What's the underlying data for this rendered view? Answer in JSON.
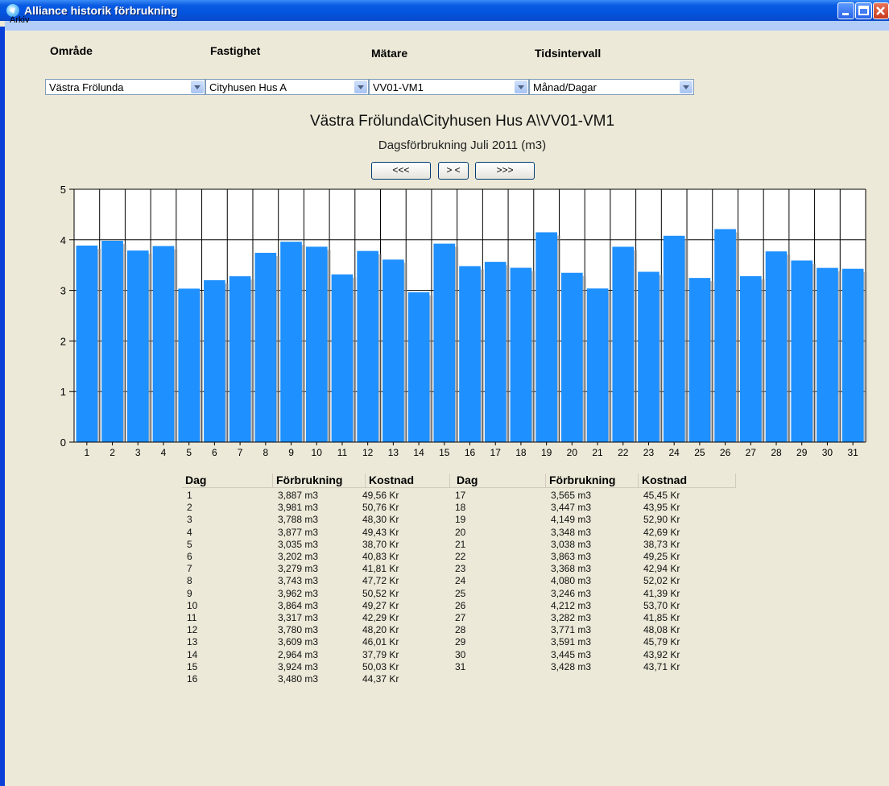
{
  "window": {
    "title": "Alliance historik förbrukning"
  },
  "menu": {
    "items": [
      "Arkiv"
    ]
  },
  "filters": {
    "area": {
      "label": "Område",
      "value": "Västra Frölunda"
    },
    "property": {
      "label": "Fastighet",
      "value": "Cityhusen Hus A"
    },
    "meter": {
      "label": "Mätare",
      "value": "VV01-VM1"
    },
    "interval": {
      "label": "Tidsintervall",
      "value": "Månad/Dagar"
    }
  },
  "navigation": {
    "prev": "<<<",
    "center": "> <",
    "next": ">>>"
  },
  "colors": {
    "bar": "#1e90ff",
    "titlebar": "#0354df",
    "background": "#ece9d8"
  },
  "chart_data": {
    "type": "bar",
    "title": "Västra Frölunda\\Cityhusen Hus A\\VV01-VM1",
    "subtitle": "Dagsförbrukning Juli 2011 (m3)",
    "categories": [
      "1",
      "2",
      "3",
      "4",
      "5",
      "6",
      "7",
      "8",
      "9",
      "10",
      "11",
      "12",
      "13",
      "14",
      "15",
      "16",
      "17",
      "18",
      "19",
      "20",
      "21",
      "22",
      "23",
      "24",
      "25",
      "26",
      "27",
      "28",
      "29",
      "30",
      "31"
    ],
    "values": [
      3.887,
      3.981,
      3.788,
      3.877,
      3.035,
      3.202,
      3.279,
      3.743,
      3.962,
      3.864,
      3.317,
      3.78,
      3.609,
      2.964,
      3.924,
      3.48,
      3.565,
      3.447,
      4.149,
      3.348,
      3.038,
      3.863,
      3.368,
      4.08,
      3.246,
      4.212,
      3.282,
      3.771,
      3.591,
      3.445,
      3.428
    ],
    "yticks": [
      "0",
      "1",
      "2",
      "3",
      "4",
      "5"
    ],
    "ylim": [
      0,
      5
    ],
    "grid": true,
    "legend": "none"
  },
  "table": {
    "headers": {
      "day": "Dag",
      "usage": "Förbrukning",
      "cost": "Kostnad"
    },
    "left": [
      {
        "day": "1",
        "usage": "3,887 m3",
        "cost": "49,56 Kr"
      },
      {
        "day": "2",
        "usage": "3,981 m3",
        "cost": "50,76 Kr"
      },
      {
        "day": "3",
        "usage": "3,788 m3",
        "cost": "48,30 Kr"
      },
      {
        "day": "4",
        "usage": "3,877 m3",
        "cost": "49,43 Kr"
      },
      {
        "day": "5",
        "usage": "3,035 m3",
        "cost": "38,70 Kr"
      },
      {
        "day": "6",
        "usage": "3,202 m3",
        "cost": "40,83 Kr"
      },
      {
        "day": "7",
        "usage": "3,279 m3",
        "cost": "41,81 Kr"
      },
      {
        "day": "8",
        "usage": "3,743 m3",
        "cost": "47,72 Kr"
      },
      {
        "day": "9",
        "usage": "3,962 m3",
        "cost": "50,52 Kr"
      },
      {
        "day": "10",
        "usage": "3,864 m3",
        "cost": "49,27 Kr"
      },
      {
        "day": "11",
        "usage": "3,317 m3",
        "cost": "42,29 Kr"
      },
      {
        "day": "12",
        "usage": "3,780 m3",
        "cost": "48,20 Kr"
      },
      {
        "day": "13",
        "usage": "3,609 m3",
        "cost": "46,01 Kr"
      },
      {
        "day": "14",
        "usage": "2,964 m3",
        "cost": "37,79 Kr"
      },
      {
        "day": "15",
        "usage": "3,924 m3",
        "cost": "50,03 Kr"
      },
      {
        "day": "16",
        "usage": "3,480 m3",
        "cost": "44,37 Kr"
      }
    ],
    "right": [
      {
        "day": "17",
        "usage": "3,565 m3",
        "cost": "45,45 Kr"
      },
      {
        "day": "18",
        "usage": "3,447 m3",
        "cost": "43,95 Kr"
      },
      {
        "day": "19",
        "usage": "4,149 m3",
        "cost": "52,90 Kr"
      },
      {
        "day": "20",
        "usage": "3,348 m3",
        "cost": "42,69 Kr"
      },
      {
        "day": "21",
        "usage": "3,038 m3",
        "cost": "38,73 Kr"
      },
      {
        "day": "22",
        "usage": "3,863 m3",
        "cost": "49,25 Kr"
      },
      {
        "day": "23",
        "usage": "3,368 m3",
        "cost": "42,94 Kr"
      },
      {
        "day": "24",
        "usage": "4,080 m3",
        "cost": "52,02 Kr"
      },
      {
        "day": "25",
        "usage": "3,246 m3",
        "cost": "41,39 Kr"
      },
      {
        "day": "26",
        "usage": "4,212 m3",
        "cost": "53,70 Kr"
      },
      {
        "day": "27",
        "usage": "3,282 m3",
        "cost": "41,85 Kr"
      },
      {
        "day": "28",
        "usage": "3,771 m3",
        "cost": "48,08 Kr"
      },
      {
        "day": "29",
        "usage": "3,591 m3",
        "cost": "45,79 Kr"
      },
      {
        "day": "30",
        "usage": "3,445 m3",
        "cost": "43,92 Kr"
      },
      {
        "day": "31",
        "usage": "3,428 m3",
        "cost": "43,71 Kr"
      }
    ]
  }
}
